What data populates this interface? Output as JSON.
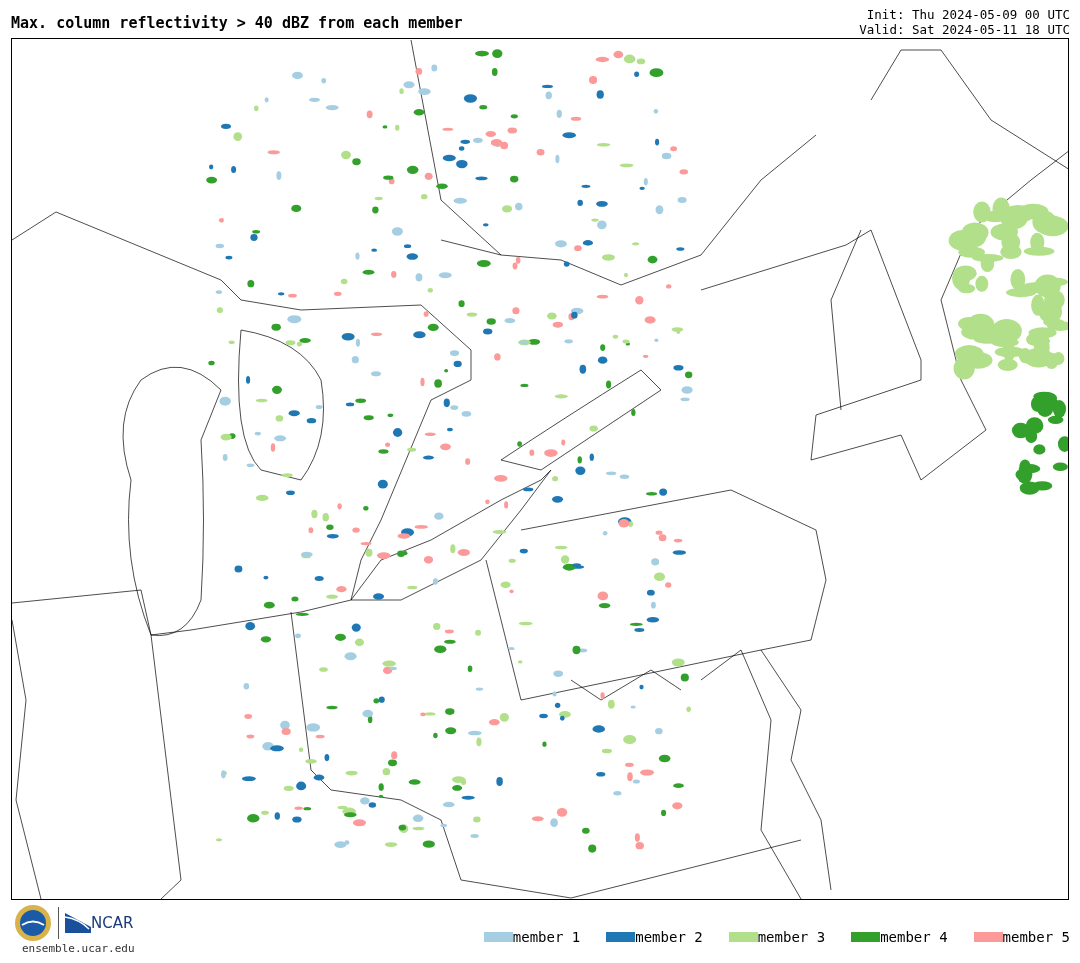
{
  "title": "Max. column reflectivity > 40 dBZ from each member",
  "init": "Init: Thu 2024-05-09 00 UTC",
  "valid": "Valid: Sat 2024-05-11 18 UTC",
  "logo": {
    "org": "NCAR",
    "url": "ensemble.ucar.edu"
  },
  "legend": [
    {
      "label": "member 1",
      "color": "#a6cee3"
    },
    {
      "label": "member 2",
      "color": "#1f78b4"
    },
    {
      "label": "member 3",
      "color": "#b2df8a"
    },
    {
      "label": "member 4",
      "color": "#33a02c"
    },
    {
      "label": "member 5",
      "color": "#fb9a99"
    }
  ]
}
